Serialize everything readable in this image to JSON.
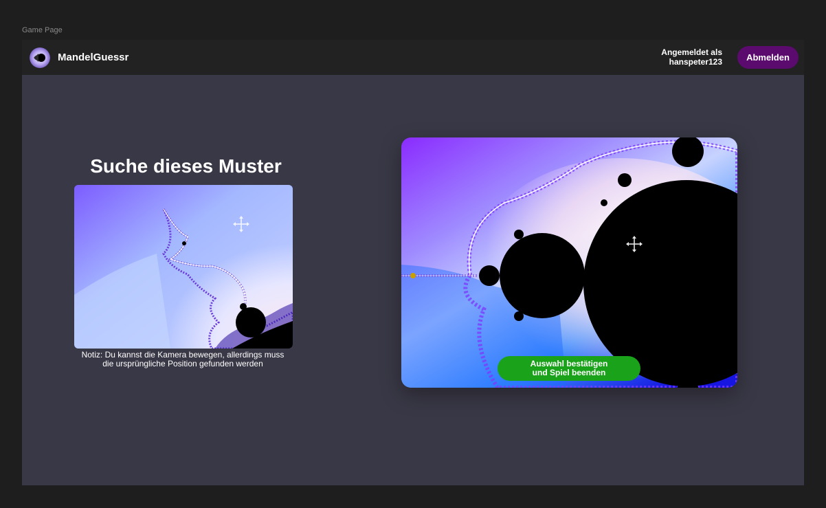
{
  "frame_label": "Game Page",
  "header": {
    "brand": "MandelGuessr",
    "user_line1": "Angemeldet als",
    "user_line2": "hanspeter123",
    "logout_label": "Abmelden"
  },
  "target": {
    "title": "Suche dieses Muster",
    "note_line1": "Notiz: Du kannst die Kamera bewegen, allerdings muss",
    "note_line2": "die ursprüngliche Position gefunden werden",
    "icon": "move-icon"
  },
  "viewport": {
    "confirm_line1": "Auswahl bestätigen",
    "confirm_line2": "und Spiel beenden",
    "icon": "move-icon"
  },
  "colors": {
    "frame_bg": "#393846",
    "navbar_bg": "#222222",
    "logout_bg": "#5b0a6e",
    "confirm_bg": "#1aa31a"
  }
}
